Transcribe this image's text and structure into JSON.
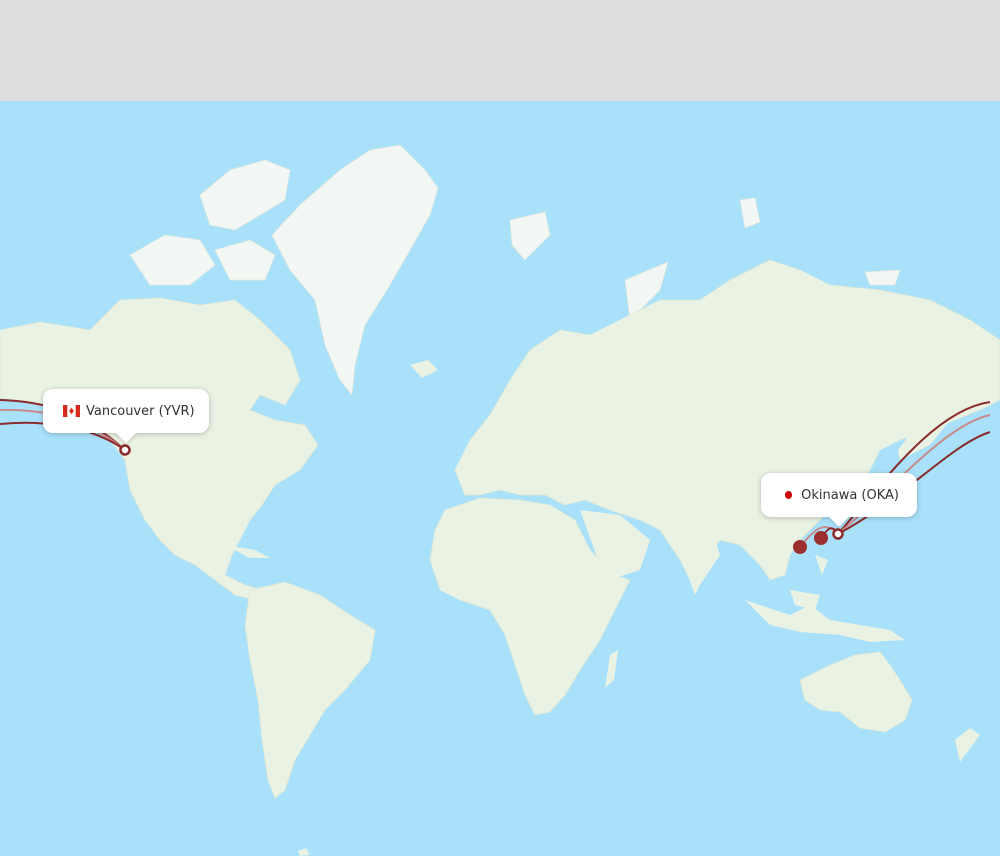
{
  "colors": {
    "ocean": "#a9e1fb",
    "land": "#eaf2e3",
    "ice": "#f3f7f4",
    "route": "#8b2b2b",
    "route_light": "#c98a8a",
    "top_band": "#dedede"
  },
  "airports": {
    "origin": {
      "label": "Vancouver (YVR)",
      "country_flag": "canada-flag-icon"
    },
    "destination": {
      "label": "Okinawa (OKA)",
      "country_flag": "japan-flag-icon"
    }
  }
}
